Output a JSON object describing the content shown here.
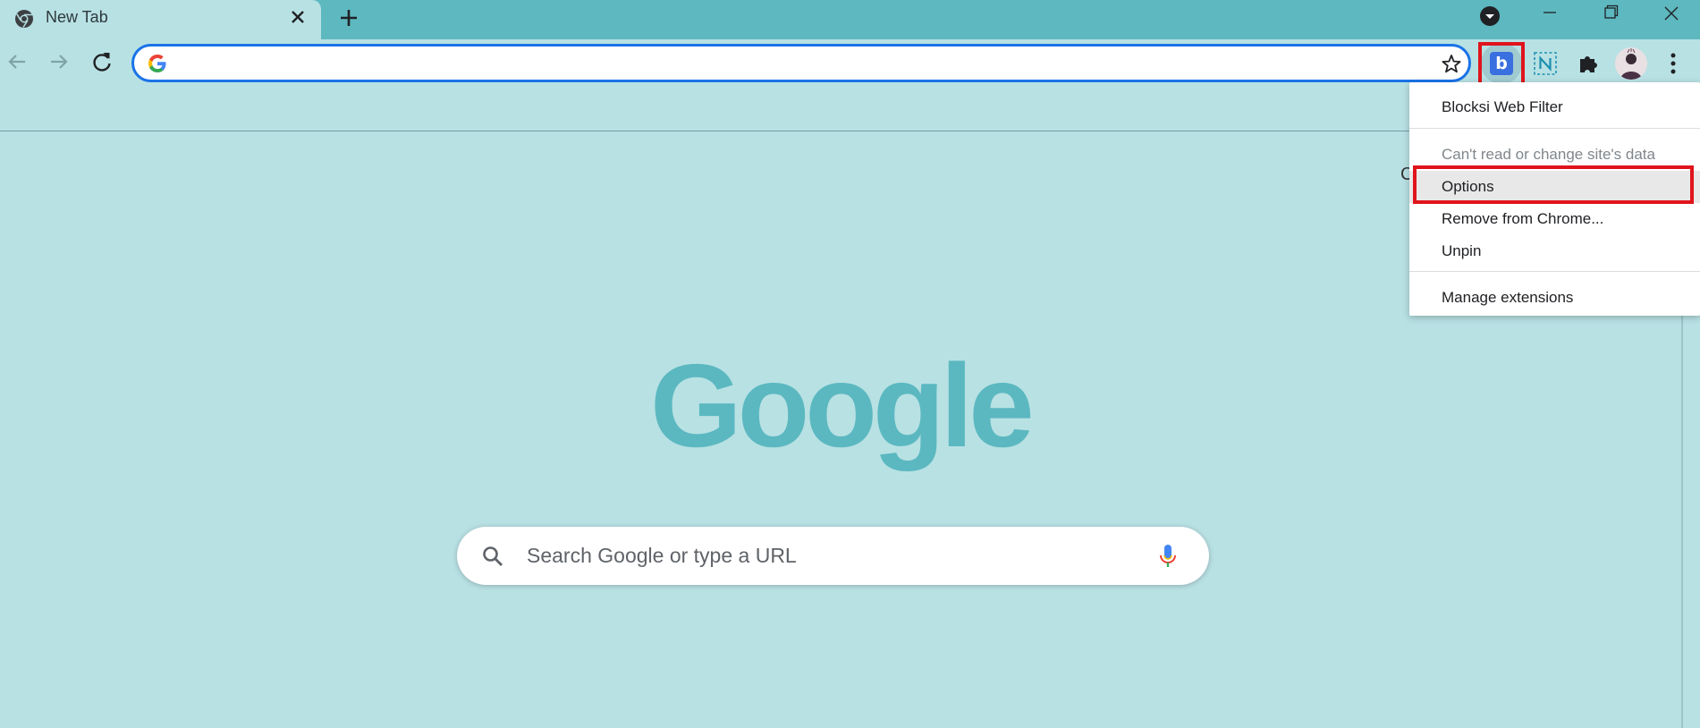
{
  "tab": {
    "title": "New Tab"
  },
  "omnibox": {
    "value": "",
    "placeholder": ""
  },
  "extension_menu": {
    "header": "Blocksi Web Filter",
    "site_access": "Can't read or change site's data",
    "options": "Options",
    "remove": "Remove from Chrome...",
    "unpin": "Unpin",
    "manage": "Manage extensions"
  },
  "blocksi_glyph": "b",
  "partial_text": "C",
  "logo": "Google",
  "search": {
    "placeholder": "Search Google or type a URL"
  },
  "colors": {
    "tabstrip": "#5db8c0",
    "page_bg": "#b8e1e4",
    "logo": "#5bb8c0",
    "highlight": "#e0141c",
    "omnibox_focus": "#1a73e8",
    "blocksi": "#3a6fe0"
  },
  "icons": [
    "chrome-icon",
    "close-icon",
    "plus-icon",
    "tab-search-icon",
    "minimize-icon",
    "restore-icon",
    "window-close-icon",
    "back-arrow-icon",
    "forward-arrow-icon",
    "reload-icon",
    "google-g-icon",
    "star-icon",
    "blocksi-icon",
    "notion-clipper-icon",
    "puzzle-icon",
    "profile-avatar",
    "kebab-menu-icon",
    "search-icon",
    "microphone-icon"
  ]
}
